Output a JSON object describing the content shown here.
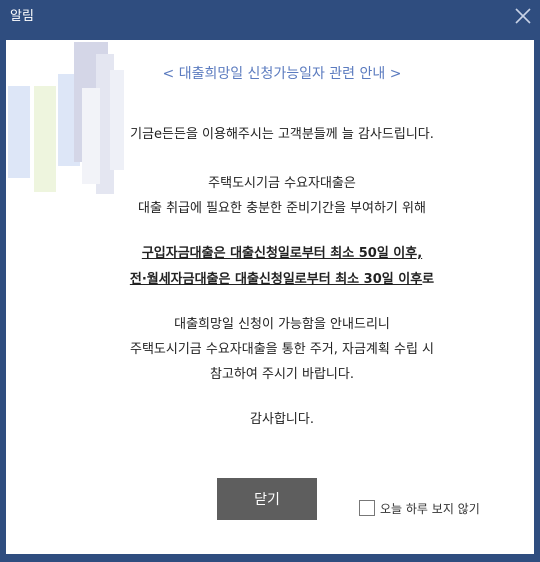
{
  "window": {
    "title": "알림"
  },
  "notice": {
    "heading": "< 대출희망일 신청가능일자 관련 안내 >",
    "p1": "기금e든든을 이용해주시는 고객분들께 늘 감사드립니다.",
    "p2_line1": "주택도시기금 수요자대출은",
    "p2_line2": "대출 취급에 필요한 충분한 준비기간을 부여하기 위해",
    "p3_line1": "구입자금대출은 대출신청일로부터 최소 50일 이후,",
    "p3_line2_underlined": "전·월세자금대출은 대출신청일로부터 최소 30일 이후",
    "p3_line2_tail": "로",
    "p4_line1": "대출희망일 신청이 가능함을 안내드리니",
    "p4_line2": "주택도시기금 수요자대출을 통한 주거, 자금계획 수립 시",
    "p4_line3": "참고하여 주시기 바랍니다.",
    "p5": "감사합니다."
  },
  "footer": {
    "close_label": "닫기",
    "dont_show_label": "오늘 하루 보지 않기",
    "dont_show_checked": false
  },
  "colors": {
    "titlebar": "#2f4d7f",
    "heading": "#5b7bbf",
    "button": "#5e5e5e"
  },
  "icons": {
    "close": "close-icon"
  }
}
